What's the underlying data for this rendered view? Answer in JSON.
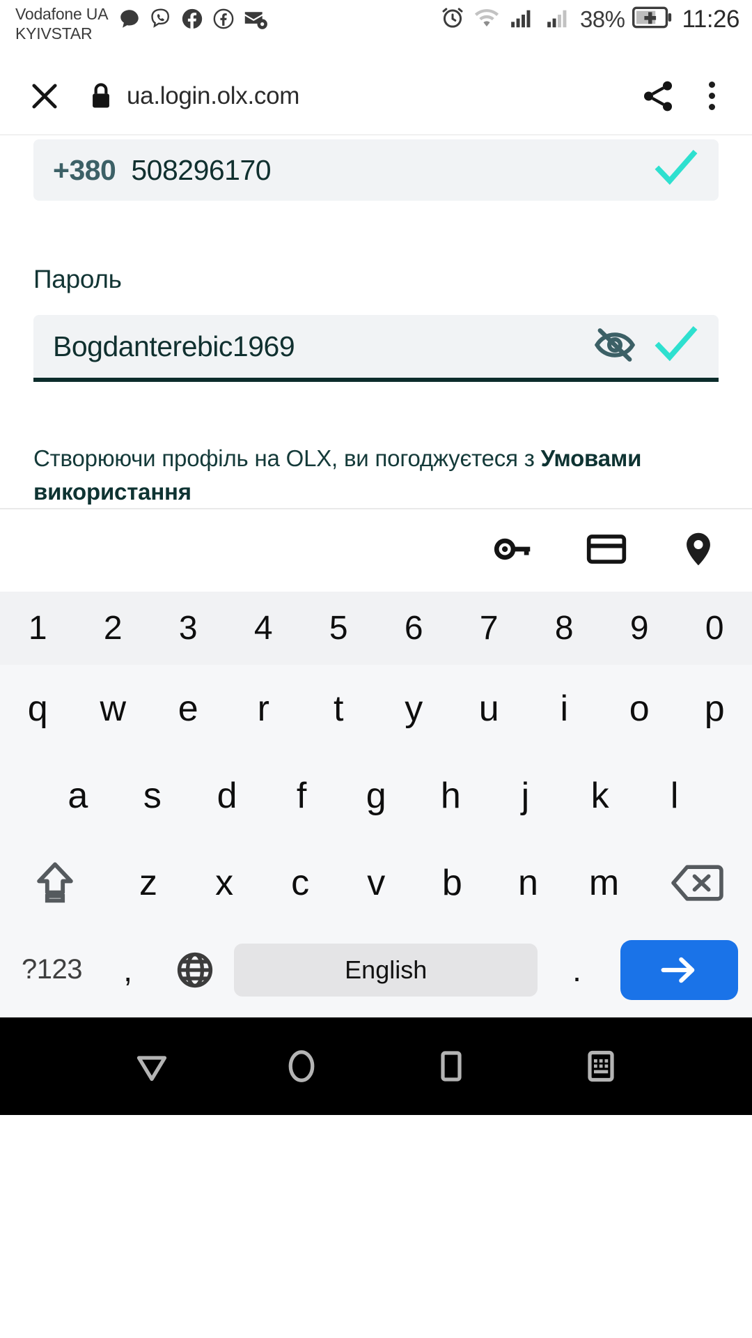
{
  "status_bar": {
    "carrier_line1": "Vodafone UA",
    "carrier_line2": "KYIVSTAR",
    "left_icons": [
      "message-icon",
      "viber-icon",
      "facebook-icon",
      "facebook-messenger-icon",
      "email-sync-icon"
    ],
    "right_icons": [
      "alarm-icon",
      "wifi-icon",
      "signal-sim1-icon",
      "signal-sim2-icon"
    ],
    "battery_percent": "38%",
    "battery_icon": "battery-charging-icon",
    "time": "11:26"
  },
  "browser_toolbar": {
    "close_label": "close-icon",
    "lock_label": "lock-icon",
    "url": "ua.login.olx.com",
    "share_label": "share-icon",
    "menu_label": "overflow-menu-icon"
  },
  "form": {
    "phone": {
      "prefix": "+380",
      "number": "508296170",
      "valid_icon": "check-icon"
    },
    "password": {
      "label": "Пароль",
      "value": "Bogdanterebic1969",
      "toggle_icon": "eye-off-icon",
      "valid_icon": "check-icon"
    },
    "terms": {
      "text": "Створюючи профіль на OLX, ви погоджуєтеся з ",
      "link": "Умовами використання"
    }
  },
  "autofill_bar": {
    "items": [
      "key-icon",
      "credit-card-icon",
      "location-pin-icon"
    ]
  },
  "keyboard": {
    "row_numbers": [
      "1",
      "2",
      "3",
      "4",
      "5",
      "6",
      "7",
      "8",
      "9",
      "0"
    ],
    "row1": [
      "q",
      "w",
      "e",
      "r",
      "t",
      "y",
      "u",
      "i",
      "o",
      "p"
    ],
    "row2": [
      "a",
      "s",
      "d",
      "f",
      "g",
      "h",
      "j",
      "k",
      "l"
    ],
    "row3": [
      "z",
      "x",
      "c",
      "v",
      "b",
      "n",
      "m"
    ],
    "shift_icon": "shift-icon",
    "backspace_icon": "backspace-icon",
    "symbols_label": "?123",
    "comma_label": ",",
    "globe_icon": "globe-icon",
    "spacebar_label": "English",
    "period_label": ".",
    "enter_icon": "enter-arrow-icon"
  },
  "nav_bar": {
    "back_icon": "back-triangle-icon",
    "home_icon": "home-circle-icon",
    "recents_icon": "recents-square-icon",
    "hide_keyboard_icon": "hide-keyboard-icon"
  },
  "colors": {
    "accent_check": "#2ee0cf",
    "field_bg": "#f1f3f5",
    "text_dark": "#10302f",
    "enter_blue": "#1a73e8",
    "prefix_teal": "#3c6066"
  }
}
